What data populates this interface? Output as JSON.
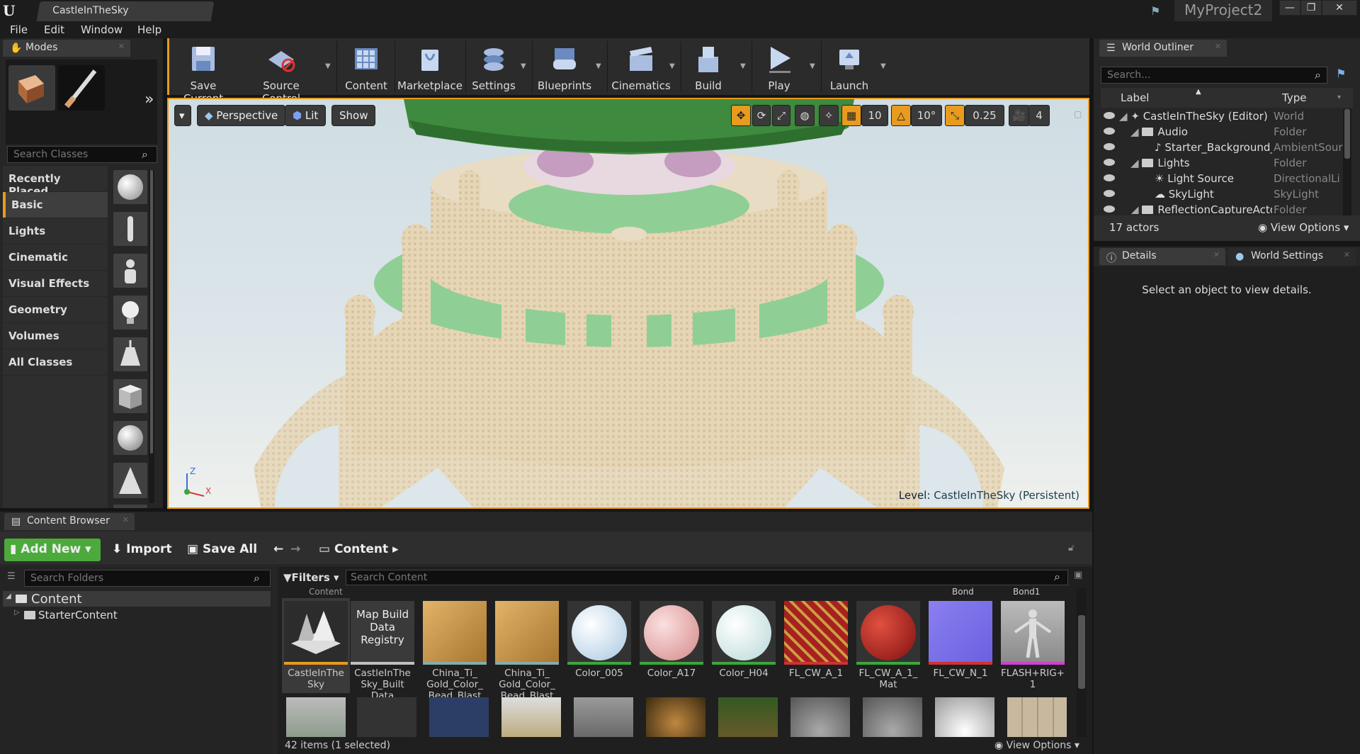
{
  "titlebar": {
    "level_tab": "CastleInTheSky",
    "project": "MyProject2",
    "min": "—",
    "max": "❐",
    "close": "✕"
  },
  "menu": [
    "File",
    "Edit",
    "Window",
    "Help"
  ],
  "modes": {
    "tab": "Modes",
    "search_placeholder": "Search Classes",
    "categories": [
      "Recently Placed",
      "Basic",
      "Lights",
      "Cinematic",
      "Visual Effects",
      "Geometry",
      "Volumes",
      "All Classes"
    ],
    "selected": "Basic"
  },
  "toolbar": {
    "items": [
      "Save Current",
      "Source Control",
      "Content",
      "Marketplace",
      "Settings",
      "Blueprints",
      "Cinematics",
      "Build",
      "Play",
      "Launch"
    ]
  },
  "viewport": {
    "perspective": "Perspective",
    "lit": "Lit",
    "show": "Show",
    "grid_snap": "10",
    "rot_snap": "10°",
    "scale_snap": "0.25",
    "cam_speed": "4",
    "level_prefix": "Level:",
    "level_name": "CastleInTheSky (Persistent)",
    "axis_z": "Z",
    "axis_x": "X"
  },
  "outliner": {
    "tab": "World Outliner",
    "search_placeholder": "Search...",
    "col_label": "Label",
    "col_type": "Type",
    "rows": [
      {
        "label": "CastleInTheSky (Editor)",
        "type": "World"
      },
      {
        "label": "Audio",
        "type": "Folder"
      },
      {
        "label": "Starter_Background_",
        "type": "AmbientSour"
      },
      {
        "label": "Lights",
        "type": "Folder"
      },
      {
        "label": "Light Source",
        "type": "DirectionalLi"
      },
      {
        "label": "SkyLight",
        "type": "SkyLight"
      },
      {
        "label": "ReflectionCaptureActor",
        "type": "Folder"
      }
    ],
    "count": "17 actors",
    "view_options": "View Options"
  },
  "details": {
    "tab_details": "Details",
    "tab_world": "World Settings",
    "empty_msg": "Select an object to view details."
  },
  "content_browser": {
    "tab": "Content Browser",
    "add_new": "Add New",
    "import": "Import",
    "save_all": "Save All",
    "path": "Content",
    "folder_search": "Search Folders",
    "filters": "Filters",
    "content_search": "Search Content",
    "tree": [
      "Content",
      "StarterContent"
    ],
    "header_labels": [
      "Content",
      "Bond",
      "Bond1"
    ],
    "assets": [
      {
        "name": "CastleInThe Sky",
        "color": "#e89b1e"
      },
      {
        "name": "CastleInThe Sky_Built Data",
        "color": "#c0c0c0",
        "tile_text": "Map Build Data Registry"
      },
      {
        "name": "China_Ti_ Gold_Color_ Bead_Blast",
        "color": "#8aa"
      },
      {
        "name": "China_Ti_ Gold_Color_ Bead_Blast",
        "color": "#8aa"
      },
      {
        "name": "Color_005",
        "color": "#3aa83a"
      },
      {
        "name": "Color_A17",
        "color": "#3aa83a"
      },
      {
        "name": "Color_H04",
        "color": "#3aa83a"
      },
      {
        "name": "FL_CW_A_1",
        "color": "#c33"
      },
      {
        "name": "FL_CW_A_1_ Mat",
        "color": "#3aa83a"
      },
      {
        "name": "FL_CW_N_1",
        "color": "#c33"
      },
      {
        "name": "FLASH+RIG+ 1",
        "color": "#d040d0"
      }
    ],
    "status": "42 items (1 selected)",
    "view_options": "View Options"
  }
}
